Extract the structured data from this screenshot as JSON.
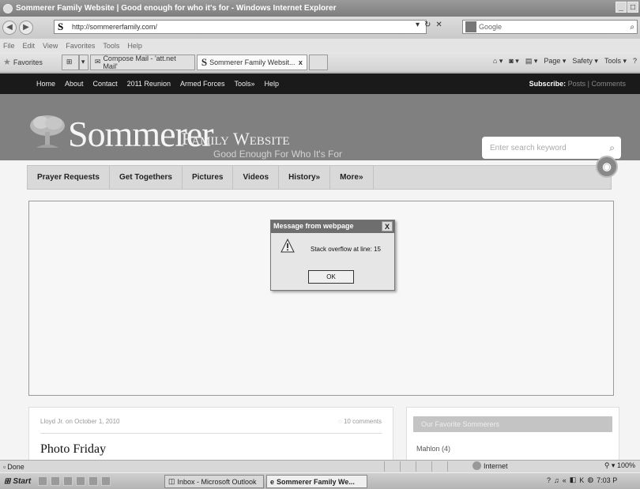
{
  "window": {
    "title": "Sommerer Family Website | Good enough for who it's for - Windows Internet Explorer",
    "buttons": [
      "_",
      "□"
    ]
  },
  "address_bar": {
    "url": "http://sommererfamily.com/",
    "search_placeholder": "Google"
  },
  "menu": [
    "File",
    "Edit",
    "View",
    "Favorites",
    "Tools",
    "Help"
  ],
  "favorites_bar": {
    "favorites_label": "Favorites",
    "tabs": [
      {
        "label": "Compose Mail - 'att.net Mail'"
      },
      {
        "label": "Sommerer Family Websit...",
        "close": "x"
      }
    ],
    "commands": [
      "Page ▾",
      "Safety ▾",
      "Tools ▾"
    ]
  },
  "site": {
    "topnav": [
      "Home",
      "About",
      "Contact",
      "2011 Reunion",
      "Armed Forces",
      "Tools»",
      "Help"
    ],
    "subscribe_label": "Subscribe:",
    "subscribe_posts": "Posts",
    "subscribe_sep": "|",
    "subscribe_comments": "Comments",
    "logo_big": "Sommerer",
    "logo_small": "Family Website",
    "tagline": "Good Enough For Who It's For",
    "search_placeholder": "Enter search keyword",
    "subnav": [
      "Prayer Requests",
      "Get Togethers",
      "Pictures",
      "Videos",
      "History»",
      "More»"
    ],
    "post": {
      "meta": "Lloyd Jr. on October 1, 2010",
      "comments": "10 comments",
      "title": "Photo Friday"
    },
    "sidebar": {
      "heading": "Our Favorite Sommerers",
      "item": "Mahlon (4)"
    }
  },
  "dialog": {
    "title": "Message from webpage",
    "close": "X",
    "message": "Stack overflow at line: 15",
    "ok": "OK"
  },
  "status_bar": {
    "status": "Done",
    "zone": "Internet",
    "zoom": "100%"
  },
  "taskbar": {
    "start": "Start",
    "tasks": [
      "Inbox - Microsoft Outlook",
      "Sommerer Family We..."
    ],
    "clock": "7:03 P"
  }
}
